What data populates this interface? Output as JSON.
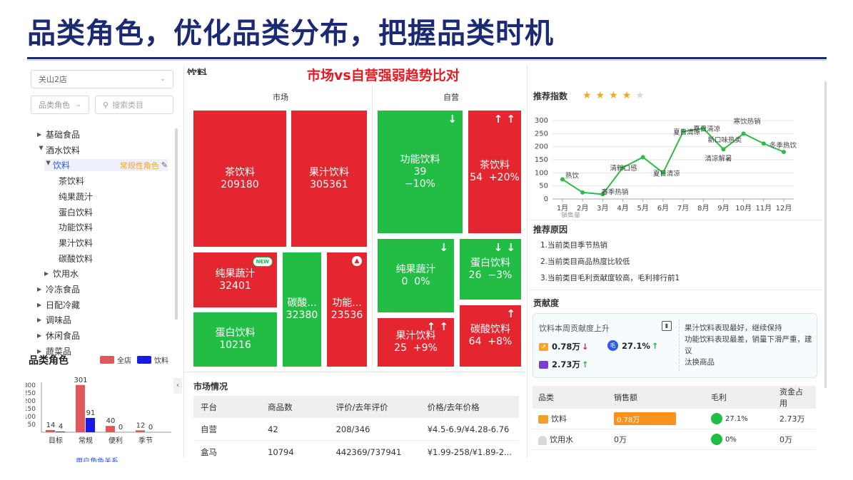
{
  "slide": {
    "title": "品类角色，优化品类分布，把握品类时机"
  },
  "overlay": {
    "title": "市场vs自营强弱趋势比对"
  },
  "sidebar": {
    "store_select": "关山2店",
    "role_select": "品类角色",
    "search_placeholder": "搜索类目",
    "tree": [
      {
        "label": "基础食品",
        "level": 0,
        "state": "collapsed"
      },
      {
        "label": "酒水饮料",
        "level": 0,
        "state": "expanded"
      },
      {
        "label": "饮料",
        "level": 1,
        "state": "expanded",
        "selected": true,
        "tag": "常规性角色"
      },
      {
        "label": "茶饮料",
        "level": 2
      },
      {
        "label": "纯果蔬汁",
        "level": 2
      },
      {
        "label": "蛋白饮料",
        "level": 2
      },
      {
        "label": "功能饮料",
        "level": 2
      },
      {
        "label": "果汁饮料",
        "level": 2
      },
      {
        "label": "碳酸饮料",
        "level": 2
      },
      {
        "label": "饮用水",
        "level": 1,
        "state": "collapsed"
      },
      {
        "label": "冷冻食品",
        "level": 0,
        "state": "collapsed"
      },
      {
        "label": "日配冷藏",
        "level": 0,
        "state": "collapsed"
      },
      {
        "label": "调味品",
        "level": 0,
        "state": "collapsed"
      },
      {
        "label": "休闲食品",
        "level": 0,
        "state": "collapsed"
      },
      {
        "label": "蔬菜品",
        "level": 0,
        "state": "collapsed"
      }
    ]
  },
  "role_chart": {
    "title": "品类角色",
    "link_partial": "用户角色关系",
    "chart_data": {
      "type": "bar",
      "title": "品类角色",
      "categories": [
        "目标",
        "常规",
        "便利",
        "季节"
      ],
      "series": [
        {
          "name": "全店",
          "color": "#e0585c",
          "values": [
            14,
            301,
            40,
            12
          ]
        },
        {
          "name": "饮料",
          "color": "#1a1ae6",
          "values": [
            4,
            91,
            0,
            0
          ]
        }
      ],
      "y_ticks_visible": [
        "300",
        "250",
        "200",
        "150",
        "100",
        "50"
      ],
      "legend": "top-right"
    }
  },
  "treemap": {
    "partial_header": "饮料",
    "market_label": "市场",
    "self_label": "自营",
    "new_badge": "NEW",
    "market": [
      {
        "name": "茶饮料",
        "value": "209180",
        "color": "red"
      },
      {
        "name": "果汁饮料",
        "value": "305361",
        "color": "red"
      },
      {
        "name": "纯果蔬汁",
        "value": "32401",
        "color": "red",
        "badge": "NEW"
      },
      {
        "name": "碳酸...",
        "value": "32380",
        "color": "green"
      },
      {
        "name": "功能...",
        "value": "23536",
        "color": "red",
        "badge": "hot"
      },
      {
        "name": "蛋白饮料",
        "value": "10216",
        "color": "green"
      }
    ],
    "self": [
      {
        "name": "功能饮料",
        "value": "39",
        "change": "−10%",
        "color": "green",
        "arrows": "↓"
      },
      {
        "name": "茶饮料",
        "value": "54",
        "change": "+20%",
        "color": "red",
        "arrows": "↑ ↑"
      },
      {
        "name": "纯果蔬汁",
        "value": "0",
        "change": "0%",
        "color": "green",
        "arrows": "↓"
      },
      {
        "name": "蛋白饮料",
        "value": "26",
        "change": "−3%",
        "color": "green",
        "arrows": "↓ ↓"
      },
      {
        "name": "果汁饮料",
        "value": "25",
        "change": "+9%",
        "color": "red",
        "arrows": "↑ ↑"
      },
      {
        "name": "碳酸饮料",
        "value": "64",
        "change": "+8%",
        "color": "red",
        "arrows": "↑"
      }
    ]
  },
  "market_table": {
    "title": "市场情况",
    "columns": [
      "平台",
      "商品数",
      "评价/去年评价",
      "价格/去年价格"
    ],
    "rows": [
      [
        "自营",
        "42",
        "208/346",
        "¥4.5-6.9/¥4.28-6.76"
      ],
      [
        "盒马",
        "10794",
        "442369/737941",
        "¥1.99-258/¥1.89-2..."
      ]
    ]
  },
  "recommend": {
    "index_label": "推荐指数",
    "stars_filled": 4,
    "stars_total": 5,
    "chart_data": {
      "type": "line",
      "x": [
        "1月",
        "2月",
        "3月",
        "4月",
        "5月",
        "6月",
        "7月",
        "8月",
        "9月",
        "10月",
        "11月",
        "12月"
      ],
      "values": [
        75,
        25,
        18,
        120,
        160,
        100,
        258,
        270,
        190,
        250,
        212,
        180
      ],
      "ylim": [
        0,
        300
      ],
      "y_ticks": [
        "0",
        "50",
        "100",
        "150",
        "200",
        "250",
        "300"
      ],
      "color": "#2dbb4a",
      "annotations": [
        {
          "text": "热饮",
          "at": "1月"
        },
        {
          "text": "春季热销",
          "at": "3月"
        },
        {
          "text": "清新口感",
          "at": "4月"
        },
        {
          "text": "夏日清凉",
          "at": "6月"
        },
        {
          "text": "夏日清凉",
          "at": "7月"
        },
        {
          "text": "夏日清凉",
          "at": "8月"
        },
        {
          "text": "新口味热卖",
          "at": "9月"
        },
        {
          "text": "清凉解暑",
          "at": "9月"
        },
        {
          "text": "寒饮热销",
          "at": "10月"
        },
        {
          "text": "冬季热饮",
          "at": "12月"
        }
      ],
      "xlabel_partial": "销售量"
    },
    "reason_title": "推荐原因",
    "reasons": [
      "1.当前类目季节热销",
      "2.当前类目商品热度比较低",
      "3.当前类目毛利贡献度较高，毛利排行前1"
    ]
  },
  "contribution": {
    "title": "贡献度",
    "card_head": "饮料本周贡献度上升",
    "metrics": [
      {
        "value": "0.78万",
        "trend": "↓"
      },
      {
        "value": "27.1%",
        "trend": "↑"
      },
      {
        "value": "2.73万",
        "trend": "↑"
      }
    ],
    "mao_glyph": "毛",
    "note_lines": [
      "果汁饮料表现最好，继续保持",
      "功能饮料表现最差，销量下滑严重，建议",
      "汰换商品"
    ],
    "table": {
      "columns": [
        "品类",
        "销售额",
        "毛利",
        "资金占用"
      ],
      "rows": [
        {
          "name": "饮料",
          "sales": "0.78万",
          "sales_ratio": 0.78,
          "margin": "27.1%",
          "capital": "2.73万"
        },
        {
          "name": "饮用水",
          "sales": "0万",
          "sales_ratio": 0,
          "margin": "0%",
          "capital": "0万"
        }
      ]
    }
  }
}
